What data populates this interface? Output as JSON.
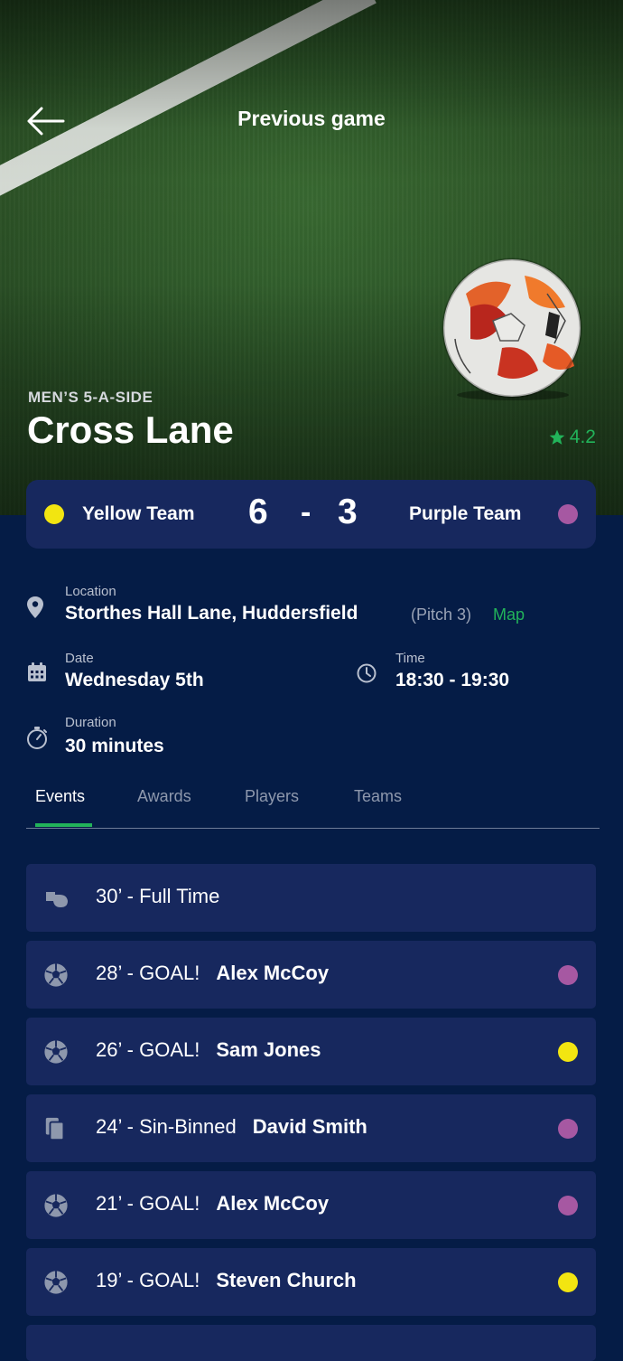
{
  "header": {
    "title": "Previous game"
  },
  "game": {
    "category": "MEN’S 5-A-SIDE",
    "venue": "Cross Lane",
    "rating": "4.2"
  },
  "score": {
    "home_team": "Yellow Team",
    "home_score": "6",
    "separator": "-",
    "away_score": "3",
    "away_team": "Purple Team",
    "home_color": "#f2e511",
    "away_color": "#a658a2"
  },
  "details": {
    "location_label": "Location",
    "location_value": "Storthes Hall Lane, Huddersfield",
    "pitch": "(Pitch 3)",
    "map_link": "Map",
    "date_label": "Date",
    "date_value": "Wednesday 5th",
    "time_label": "Time",
    "time_value": "18:30 - 19:30",
    "duration_label": "Duration",
    "duration_value": "30 minutes"
  },
  "tabs": [
    "Events",
    "Awards",
    "Players",
    "Teams"
  ],
  "active_tab": "Events",
  "events": [
    {
      "icon": "whistle-icon",
      "text": "30’ - Full Time",
      "player": "",
      "team_color": ""
    },
    {
      "icon": "football-icon",
      "text": "28’ - GOAL!",
      "player": "Alex McCoy",
      "team_color": "#a658a2"
    },
    {
      "icon": "football-icon",
      "text": "26’ - GOAL!",
      "player": "Sam Jones",
      "team_color": "#f2e511"
    },
    {
      "icon": "card-icon",
      "text": "24’ - Sin-Binned",
      "player": "David Smith",
      "team_color": "#a658a2"
    },
    {
      "icon": "football-icon",
      "text": "21’ - GOAL!",
      "player": "Alex McCoy",
      "team_color": "#a658a2"
    },
    {
      "icon": "football-icon",
      "text": "19’ - GOAL!",
      "player": "Steven Church",
      "team_color": "#f2e511"
    }
  ],
  "colors": {
    "background": "#051c46",
    "card": "#17285e",
    "accent_green": "#22b35a"
  }
}
